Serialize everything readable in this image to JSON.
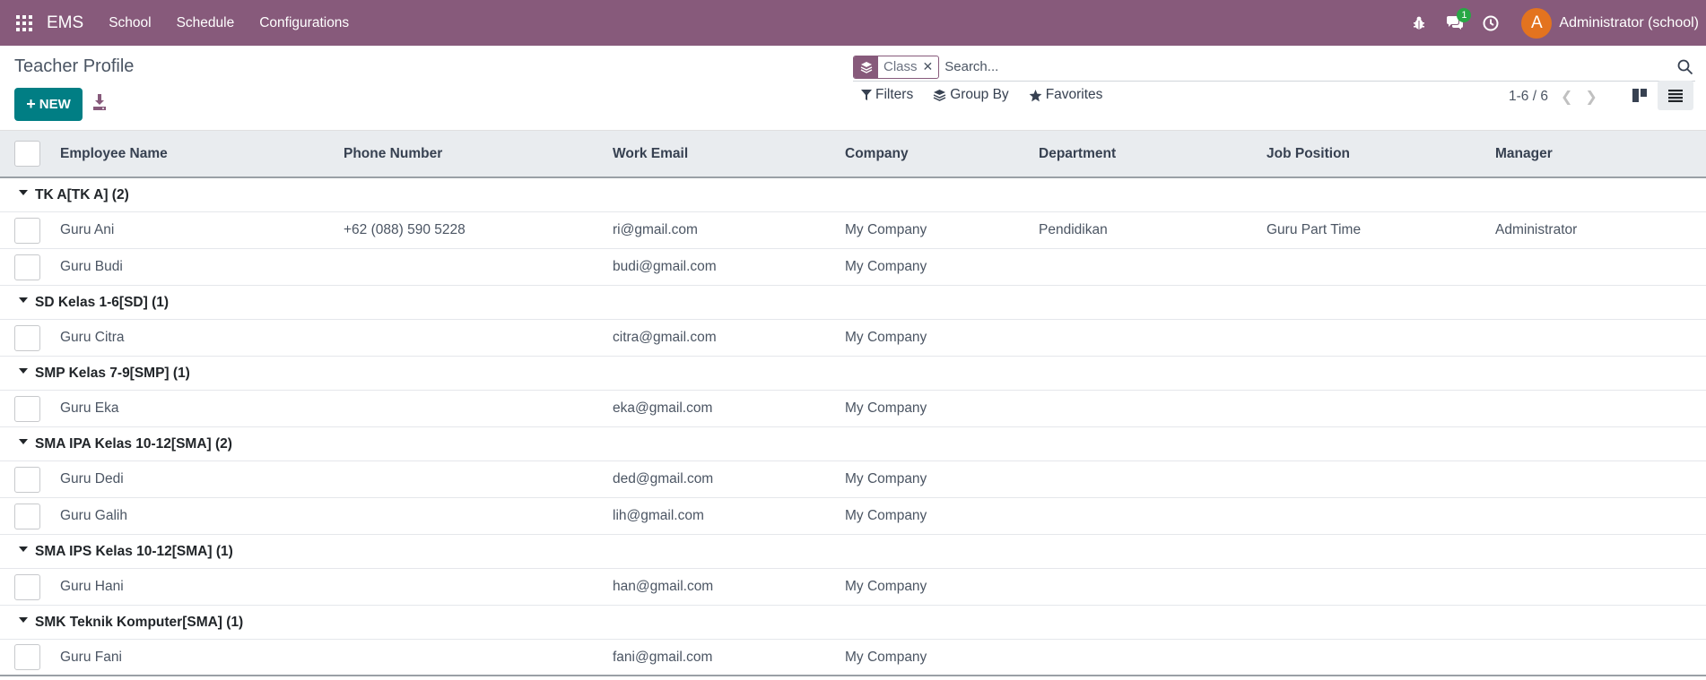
{
  "navbar": {
    "app_name": "EMS",
    "menu": [
      "School",
      "Schedule",
      "Configurations"
    ],
    "chat_badge": "1",
    "avatar_letter": "A",
    "user": "Administrator (school)"
  },
  "control_panel": {
    "title": "Teacher Profile",
    "new_label": "NEW",
    "facet_label": "Class",
    "search_placeholder": "Search...",
    "filters_label": "Filters",
    "group_by_label": "Group By",
    "favorites_label": "Favorites",
    "pager": "1-6 / 6"
  },
  "table": {
    "columns": [
      "Employee Name",
      "Phone Number",
      "Work Email",
      "Company",
      "Department",
      "Job Position",
      "Manager"
    ],
    "groups": [
      {
        "label": "TK A[TK A] (2)",
        "rows": [
          {
            "name": "Guru Ani",
            "phone": "+62 (088) 590 5228",
            "email": "ri@gmail.com",
            "company": "My Company",
            "department": "Pendidikan",
            "job": "Guru Part Time",
            "manager": "Administrator"
          },
          {
            "name": "Guru Budi",
            "phone": "",
            "email": "budi@gmail.com",
            "company": "My Company",
            "department": "",
            "job": "",
            "manager": ""
          }
        ]
      },
      {
        "label": "SD Kelas 1-6[SD] (1)",
        "rows": [
          {
            "name": "Guru Citra",
            "phone": "",
            "email": "citra@gmail.com",
            "company": "My Company",
            "department": "",
            "job": "",
            "manager": ""
          }
        ]
      },
      {
        "label": "SMP Kelas 7-9[SMP] (1)",
        "rows": [
          {
            "name": "Guru Eka",
            "phone": "",
            "email": "eka@gmail.com",
            "company": "My Company",
            "department": "",
            "job": "",
            "manager": ""
          }
        ]
      },
      {
        "label": "SMA IPA Kelas 10-12[SMA] (2)",
        "rows": [
          {
            "name": "Guru Dedi",
            "phone": "",
            "email": "ded@gmail.com",
            "company": "My Company",
            "department": "",
            "job": "",
            "manager": ""
          },
          {
            "name": "Guru Galih",
            "phone": "",
            "email": "lih@gmail.com",
            "company": "My Company",
            "department": "",
            "job": "",
            "manager": ""
          }
        ]
      },
      {
        "label": "SMA IPS Kelas 10-12[SMA] (1)",
        "rows": [
          {
            "name": "Guru Hani",
            "phone": "",
            "email": "han@gmail.com",
            "company": "My Company",
            "department": "",
            "job": "",
            "manager": ""
          }
        ]
      },
      {
        "label": "SMK Teknik Komputer[SMA] (1)",
        "rows": [
          {
            "name": "Guru Fani",
            "phone": "",
            "email": "fani@gmail.com",
            "company": "My Company",
            "department": "",
            "job": "",
            "manager": ""
          }
        ]
      }
    ]
  },
  "colors": {
    "brand": "#875a7b",
    "primary": "#017e84",
    "badge": "#28a745",
    "avatar": "#e3731f"
  }
}
